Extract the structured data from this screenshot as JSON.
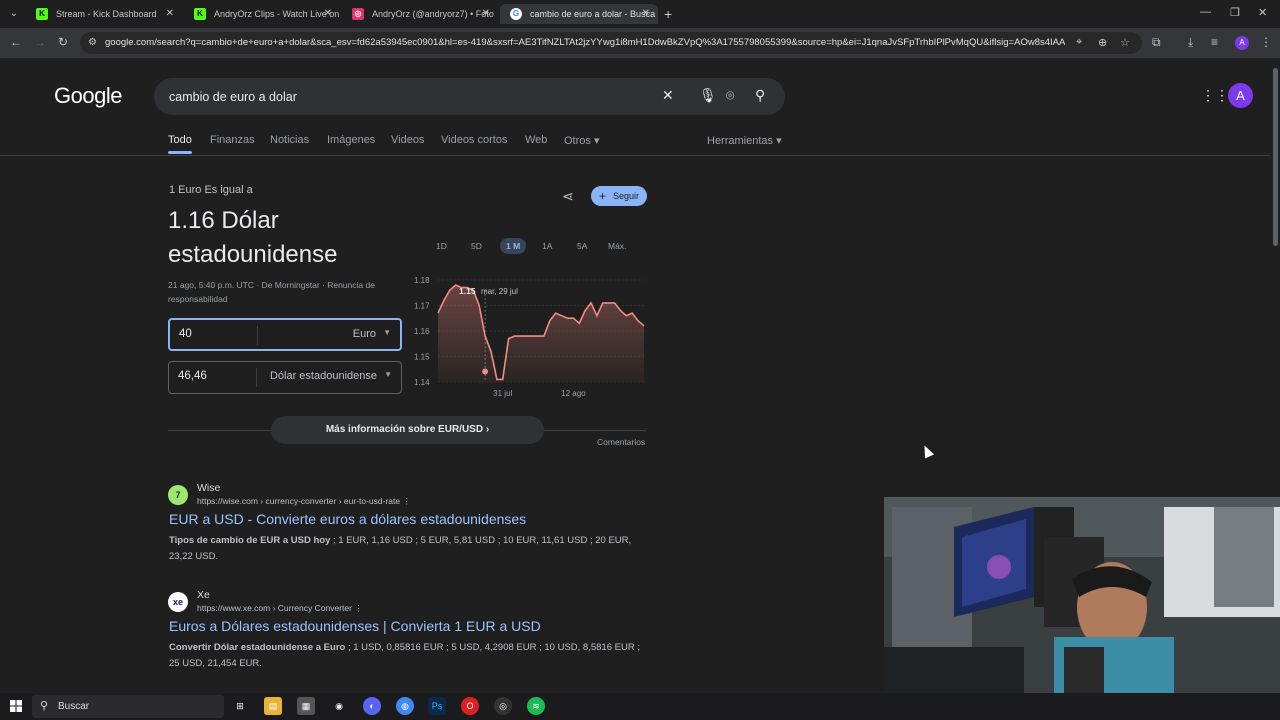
{
  "browser": {
    "tabs": [
      {
        "title": "Stream - Kick Dashboard",
        "favicon": "K",
        "color": "#53fc18"
      },
      {
        "title": "AndryOrz Clips - Watch Live on",
        "favicon": "K",
        "color": "#53fc18"
      },
      {
        "title": "AndryOrz (@andryorz7) • Foto",
        "favicon": "◎",
        "color": "#e1306c"
      },
      {
        "title": "cambio de euro a dolar - Busca",
        "favicon": "G",
        "color": "#4285f4"
      }
    ],
    "url": "google.com/search?q=cambio+de+euro+a+dolar&sca_esv=fd62a53945ec0901&hl=es-419&sxsrf=AE3TifNZLTAt2jzYYwg1i8mH1DdwBkZVpQ%3A1755798055399&source=hp&ei=J1qnaJvSFpTrhbIPlPvMqQU&iflsig=AOw8s4IAAAAAa...",
    "profile_initial": "A"
  },
  "google": {
    "logo": "Google",
    "query": "cambio de euro a dolar",
    "avatar_initial": "A",
    "nav": [
      "Todo",
      "Finanzas",
      "Noticias",
      "Imágenes",
      "Videos",
      "Videos cortos",
      "Web",
      "Otros ▾",
      "Herramientas ▾"
    ]
  },
  "converter": {
    "label": "1 Euro Es igual a",
    "value": "1.16 Dólar estadounidense",
    "meta": "21 ago, 5:40 p.m. UTC · De Morningstar · Renuncia de responsabilidad",
    "from_amount": "40",
    "from_currency": "Euro",
    "to_amount": "46,46",
    "to_currency": "Dólar estadounidense",
    "follow": "Seguir",
    "ranges": [
      "1D",
      "5D",
      "1 M",
      "1A",
      "5A",
      "Máx."
    ],
    "active_range": "1 M",
    "more": "Más información sobre EUR/USD  ›",
    "feedback": "Comentarios",
    "tooltip_value": "1.15",
    "tooltip_date": "mar, 29 jul"
  },
  "chart_data": {
    "type": "area",
    "y_ticks": [
      "1.18",
      "1.17",
      "1.16",
      "1.15",
      "1.14"
    ],
    "x_ticks": [
      "31 jul",
      "12 ago"
    ],
    "ylim": [
      1.14,
      1.18
    ],
    "values": [
      1.167,
      1.172,
      1.176,
      1.178,
      1.177,
      1.177,
      1.176,
      1.17,
      1.158,
      1.152,
      1.141,
      1.141,
      1.157,
      1.158,
      1.158,
      1.158,
      1.158,
      1.158,
      1.158,
      1.164,
      1.167,
      1.166,
      1.165,
      1.165,
      1.163,
      1.168,
      1.171,
      1.166,
      1.171,
      1.171,
      1.171,
      1.168,
      1.166,
      1.167,
      1.164,
      1.162
    ],
    "series_color": "#f28b82",
    "highlight_value": 1.15
  },
  "results": [
    {
      "site": "Wise",
      "cite": "https://wise.com › currency-converter › eur-to-usd-rate  ⋮",
      "title": "EUR a USD - Convierte euros a dólares estadounidenses",
      "snippet_bold": "Tipos de cambio de EUR a USD hoy",
      "snippet": " ; 1 EUR, 1,16 USD ; 5 EUR, 5,81 USD ; 10 EUR, 11,61 USD ; 20 EUR, 23,22 USD.",
      "fav": "7",
      "fav_color": "#9fe870"
    },
    {
      "site": "Xe",
      "cite": "https://www.xe.com › Currency Converter  ⋮",
      "title": "Euros a Dólares estadounidenses | Convierta 1 EUR a USD",
      "snippet_bold": "Convertir Dólar estadounidense a Euro",
      "snippet": " ; 1 USD, 0,85816 EUR ; 5 USD, 4,2908 EUR ; 10 USD, 8,5816 EUR ; 25 USD, 21,454 EUR.",
      "fav": "xe",
      "fav_color": "#ffffff"
    }
  ],
  "taskbar": {
    "search": "Buscar"
  }
}
